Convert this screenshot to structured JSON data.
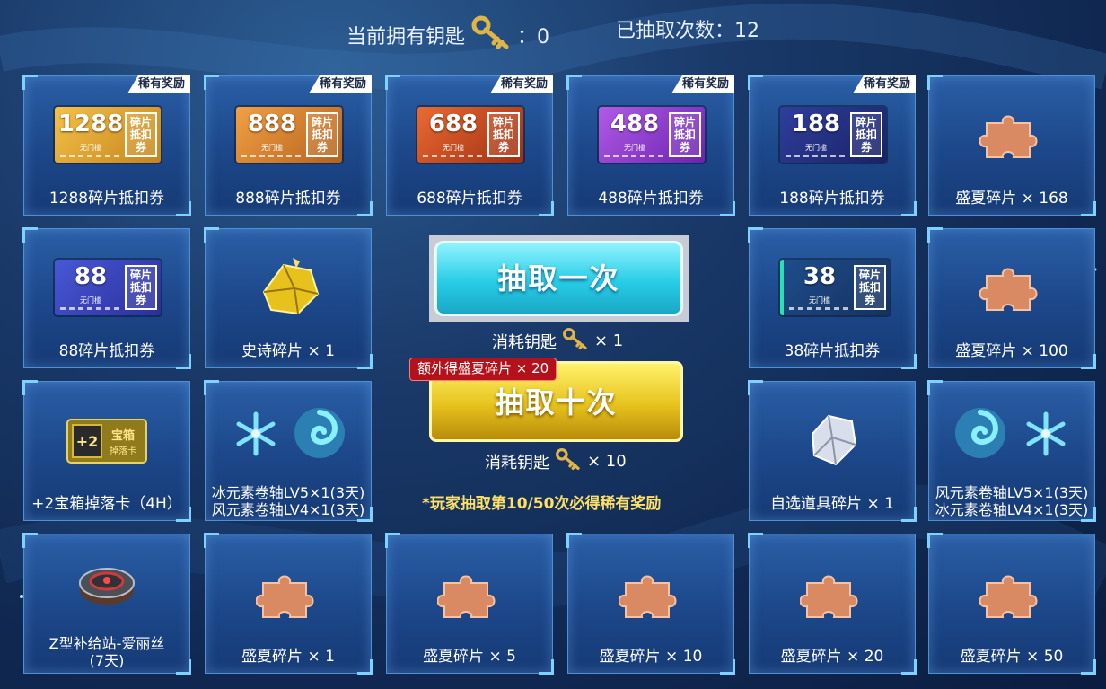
{
  "header": {
    "keys_label": "当前拥有钥匙",
    "keys_value": "：0",
    "draws_text": "已抽取次数：12"
  },
  "rare_badge": "稀有奖励",
  "tickets": [
    {
      "num": "1288",
      "sub": "无门槛",
      "side": "碎片抵扣券",
      "label": "1288碎片抵扣券"
    },
    {
      "num": "888",
      "sub": "无门槛",
      "side": "碎片抵扣券",
      "label": "888碎片抵扣券"
    },
    {
      "num": "688",
      "sub": "无门槛",
      "side": "碎片抵扣券",
      "label": "688碎片抵扣券"
    },
    {
      "num": "488",
      "sub": "无门槛",
      "side": "碎片抵扣券",
      "label": "488碎片抵扣券"
    },
    {
      "num": "188",
      "sub": "无门槛",
      "side": "碎片抵扣券",
      "label": "188碎片抵扣券"
    },
    {
      "num": "88",
      "sub": "无门槛",
      "side": "碎片抵扣券",
      "label": "88碎片抵扣券"
    },
    {
      "num": "38",
      "sub": "无门槛",
      "side": "碎片抵扣券",
      "label": "38碎片抵扣券"
    }
  ],
  "items": {
    "summer_168": "盛夏碎片 × 168",
    "summer_100": "盛夏碎片 × 100",
    "epic": "史诗碎片 × 1",
    "chest_card": "+2宝箱掉落卡（4H）",
    "chest_card_art": "+2",
    "chest_card_art2": "宝箱",
    "chest_card_art3": "掉落卡",
    "ice_wind_1": "冰元素卷轴LV5×1(3天)",
    "ice_wind_2": "风元素卷轴LV4×1(3天)",
    "optional": "自选道具碎片 × 1",
    "wind_ice_1": "风元素卷轴LV5×1(3天)",
    "wind_ice_2": "冰元素卷轴LV4×1(3天)",
    "supply_1": "Z型补给站-爱丽丝",
    "supply_2": "(7天)",
    "summer_1": "盛夏碎片 × 1",
    "summer_5": "盛夏碎片 × 5",
    "summer_10": "盛夏碎片 × 10",
    "summer_20": "盛夏碎片 × 20",
    "summer_50": "盛夏碎片 × 50"
  },
  "draw": {
    "one_label": "抽取一次",
    "one_cost_prefix": "消耗钥匙",
    "one_cost_suffix": "× 1",
    "ten_label": "抽取十次",
    "ten_cost_prefix": "消耗钥匙",
    "ten_cost_suffix": "× 10",
    "extra_tag": "额外得盛夏碎片 × 20",
    "guarantee_note": "*玩家抽取第10/50次必得稀有奖励"
  },
  "colors": {
    "accent_cyan": "#27cde6",
    "accent_gold": "#e7c21d",
    "note_yellow": "#ffe067",
    "badge_red": "#b3121a"
  }
}
